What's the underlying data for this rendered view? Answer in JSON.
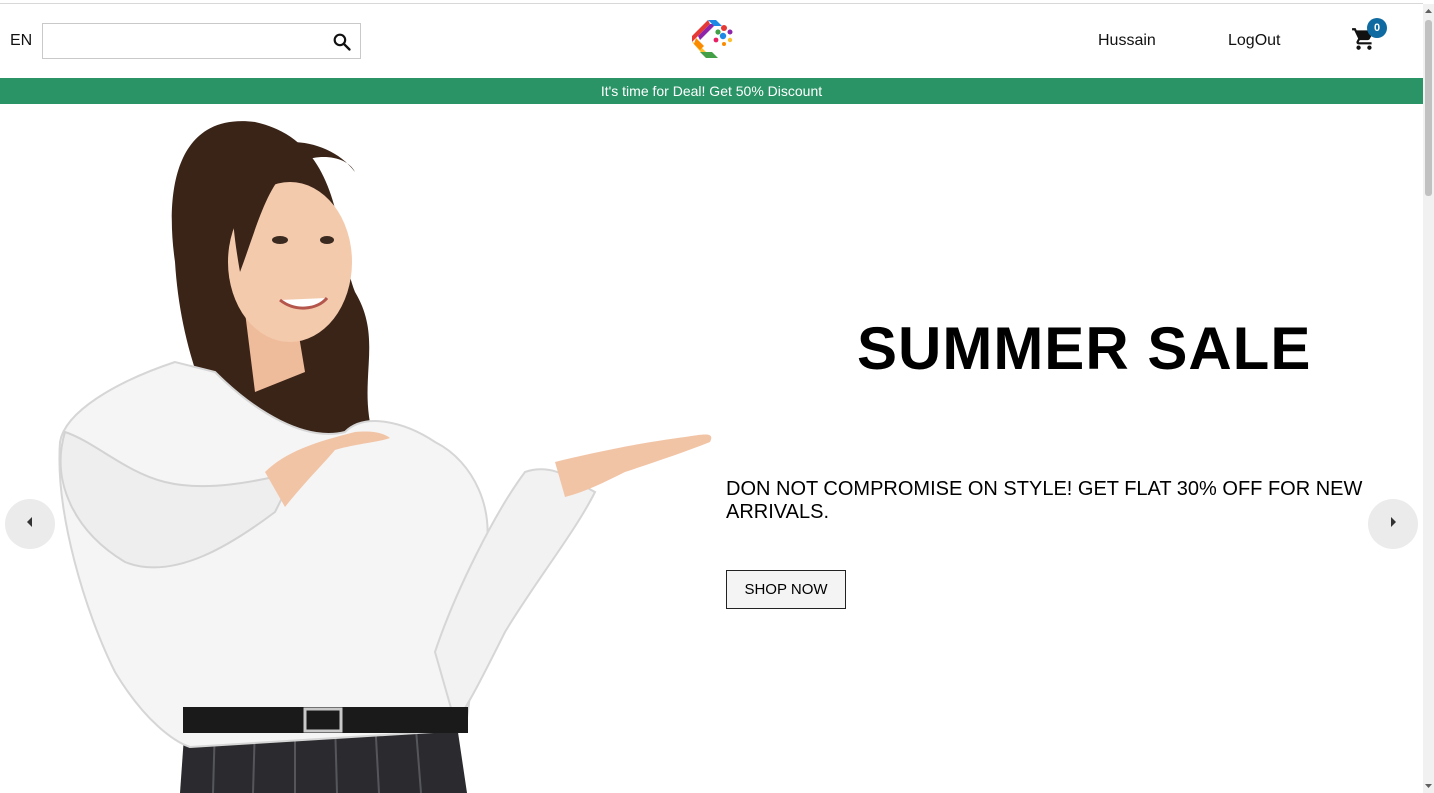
{
  "header": {
    "language": "EN",
    "search": {
      "value": "",
      "placeholder": ""
    },
    "user_name": "Hussain",
    "logout_label": "LogOut",
    "cart_count": "0",
    "logo_icon": "colorful-c-logo-icon",
    "cart_icon": "shopping-cart-icon"
  },
  "promo_bar": {
    "text": "It's time for Deal! Get 50% Discount",
    "color": "#2a9466"
  },
  "hero": {
    "title": "SUMMER SALE",
    "description": "DON NOT COMPROMISE ON STYLE! GET FLAT 30% OFF FOR NEW ARRIVALS.",
    "button_label": "SHOP NOW",
    "prev_icon": "chevron-left-icon",
    "next_icon": "chevron-right-icon"
  },
  "colors": {
    "accent": "#2a9466",
    "badge": "#0e6aa0"
  }
}
